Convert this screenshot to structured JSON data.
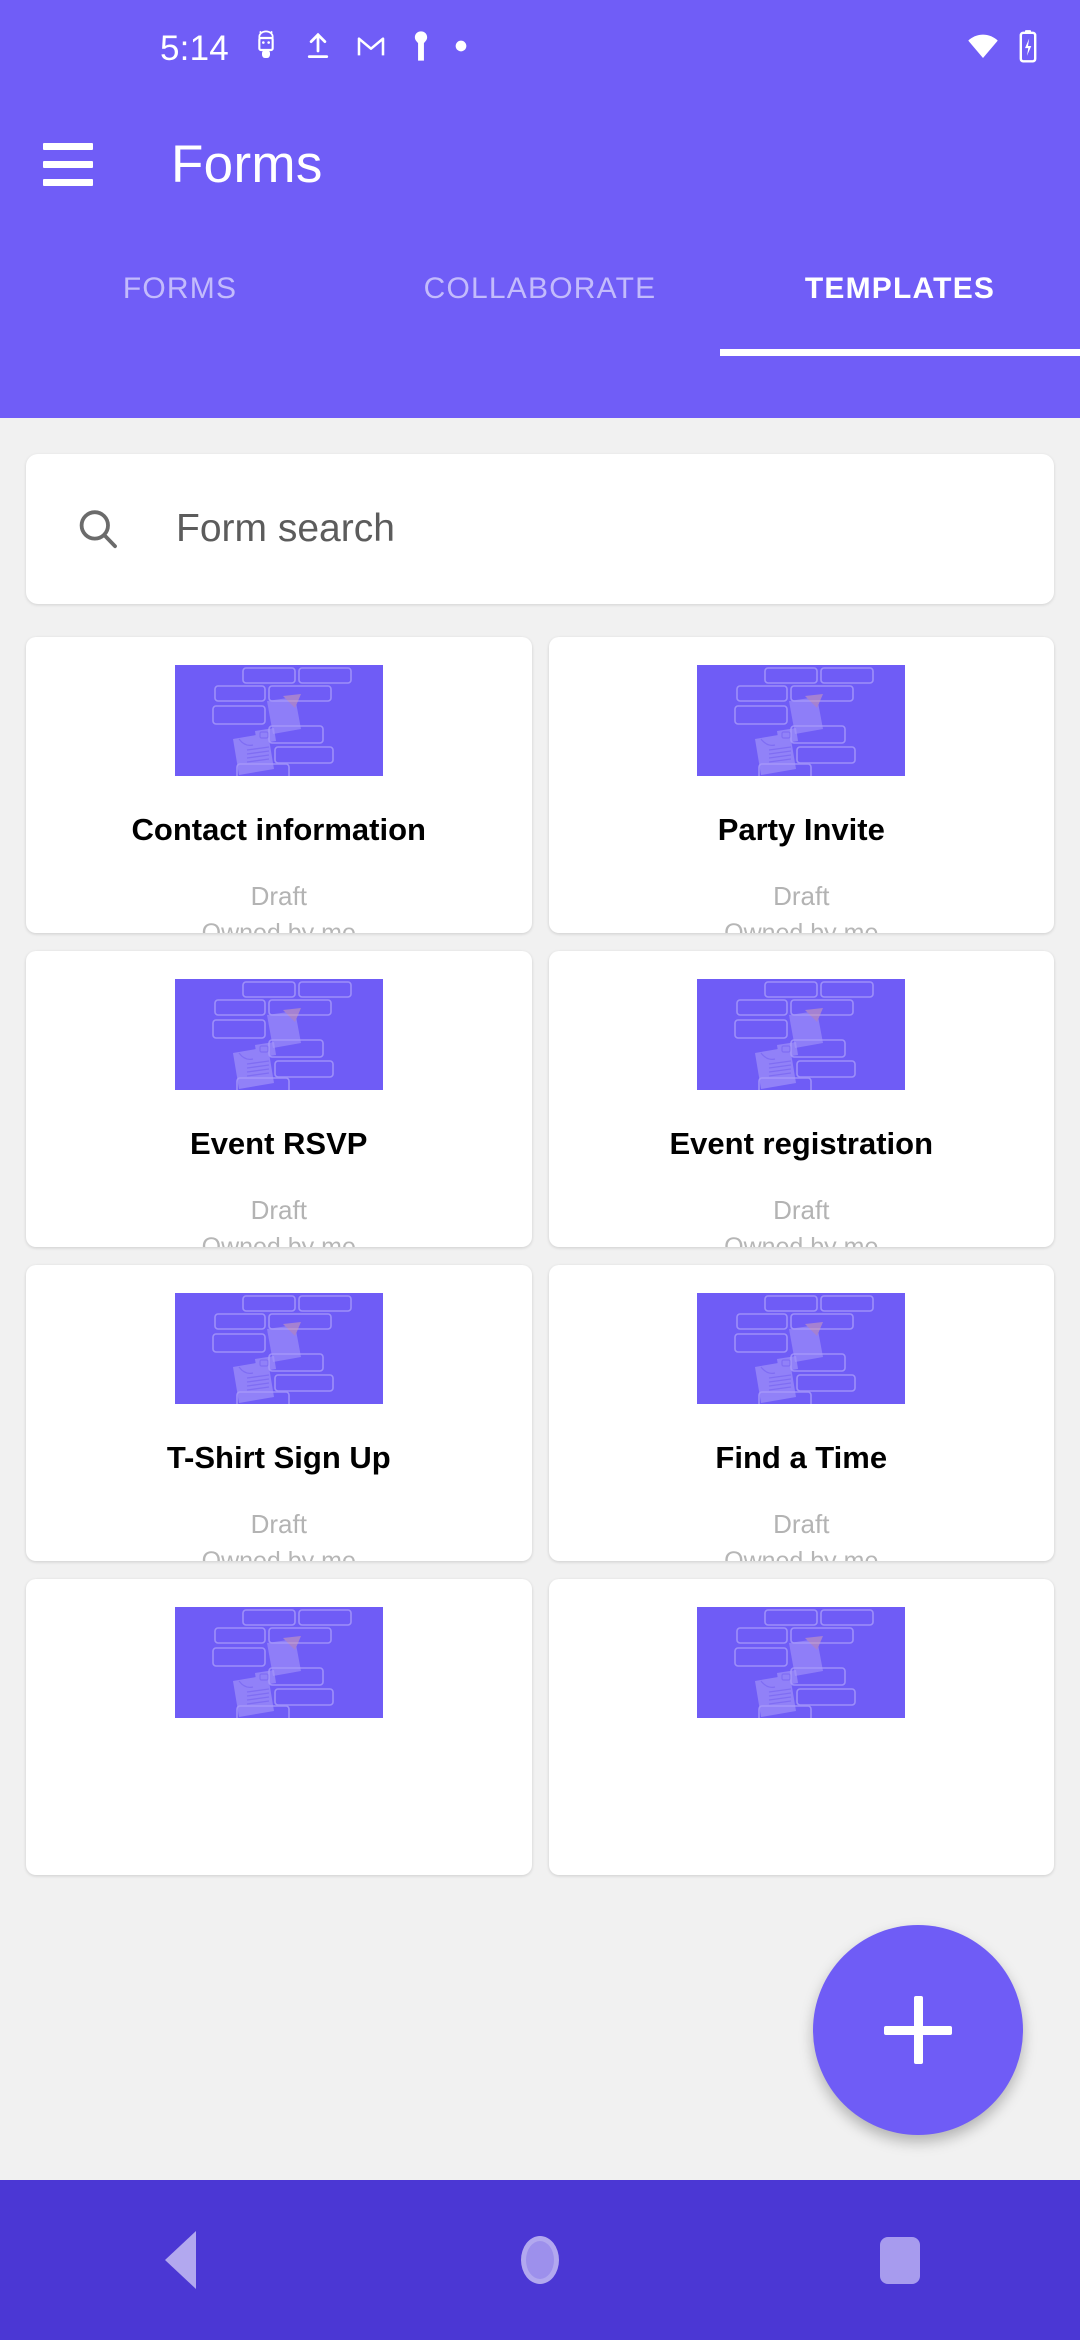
{
  "status_bar": {
    "time": "5:14",
    "left_icons": [
      "android-icon",
      "upload-icon",
      "gmail-icon",
      "person-icon",
      "dot-icon"
    ],
    "right_icons": [
      "wifi-icon",
      "battery-charging-icon"
    ]
  },
  "app_bar": {
    "menu_icon": "hamburger-menu-icon",
    "title": "Forms"
  },
  "tabs": [
    {
      "label": "FORMS",
      "active": false
    },
    {
      "label": "COLLABORATE",
      "active": false
    },
    {
      "label": "TEMPLATES",
      "active": true
    }
  ],
  "search": {
    "icon": "search-icon",
    "placeholder": "Form search",
    "value": ""
  },
  "templates": [
    {
      "title": "Contact information",
      "status": "Draft",
      "owner": "Owned by me"
    },
    {
      "title": "Party Invite",
      "status": "Draft",
      "owner": "Owned by me"
    },
    {
      "title": "Event RSVP",
      "status": "Draft",
      "owner": "Owned by me"
    },
    {
      "title": "Event registration",
      "status": "Draft",
      "owner": "Owned by me"
    },
    {
      "title": "T-Shirt Sign Up",
      "status": "Draft",
      "owner": "Owned by me"
    },
    {
      "title": "Find a Time",
      "status": "Draft",
      "owner": "Owned by me"
    },
    {
      "title": "",
      "status": "",
      "owner": ""
    },
    {
      "title": "",
      "status": "",
      "owner": ""
    }
  ],
  "fab": {
    "icon": "plus-icon",
    "label": "Create new form"
  },
  "nav_bar": {
    "back": "back-triangle-icon",
    "home": "home-circle-icon",
    "recents": "recents-square-icon"
  },
  "colors": {
    "header_purple": "#705DF7",
    "nav_purple": "#4B37D4",
    "thumb_purple": "#6F5CF6",
    "page_bg": "#F1F1F1",
    "card_bg": "#FFFFFF",
    "muted_text": "#B3B3B3"
  }
}
